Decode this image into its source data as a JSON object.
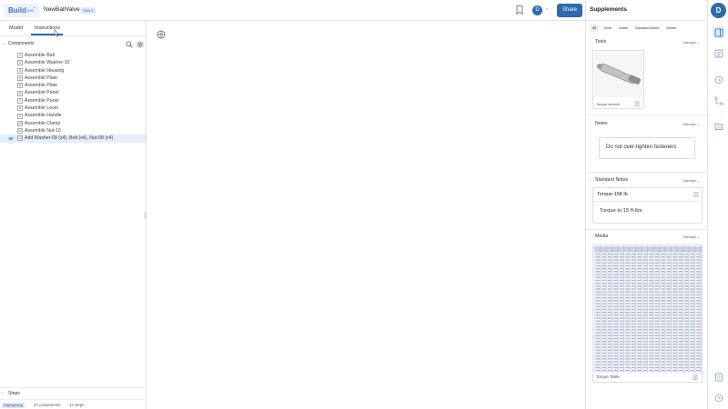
{
  "topbar": {
    "logo_text": "Build",
    "logo_superscript": "395",
    "document_title": "NewBallValve",
    "revision": "Rev 1",
    "user_initial": "D",
    "share_label": "Share"
  },
  "left_panel": {
    "tabs": [
      {
        "label": "Model"
      },
      {
        "label": "Instructions"
      }
    ],
    "components_title": "Components",
    "steps": [
      {
        "num": "1",
        "label": "Assemble Ball"
      },
      {
        "num": "2",
        "label": "Assemble Washer-10"
      },
      {
        "num": "3",
        "label": "Assemble Housing"
      },
      {
        "num": "4",
        "label": "Assemble Plate"
      },
      {
        "num": "5",
        "label": "Assemble Plate"
      },
      {
        "num": "6",
        "label": "Assemble Panel"
      },
      {
        "num": "7",
        "label": "Assemble Panel"
      },
      {
        "num": "8",
        "label": "Assemble Lever"
      },
      {
        "num": "9",
        "label": "Assemble Handle"
      },
      {
        "num": "10",
        "label": "Assemble Clamp"
      },
      {
        "num": "11",
        "label": "Assemble Nut-10"
      },
      {
        "num": "12",
        "label": "Add Washer-08 (x4), Bolt (x4), Nut-08 (x4)"
      }
    ],
    "steps_section_title": "Steps",
    "status": {
      "mode": "Highlighting",
      "components": "27 components",
      "steps": "12 steps"
    }
  },
  "supplements": {
    "title": "Supplements",
    "tabs": [
      {
        "label": "All"
      },
      {
        "label": "Tools"
      },
      {
        "label": "Notes"
      },
      {
        "label": "Standard Notes"
      },
      {
        "label": "Media"
      }
    ],
    "manage_label": "Manage",
    "tools": {
      "title": "Tools",
      "item_name": "Torque wrench"
    },
    "notes": {
      "title": "Notes",
      "text": "Do not over-tighten fasteners"
    },
    "standard_notes": {
      "title": "Standard Notes",
      "item_name": "Torque-15ft lb",
      "text": "Torque to 15 ft-lbs"
    },
    "media": {
      "title": "Media",
      "item_name": "Torque Table"
    }
  },
  "right_rail": {
    "user_initial": "D"
  },
  "colors": {
    "accent": "#2d6ab0",
    "selected_row": "#e4edf8",
    "border": "#e2e2e2"
  }
}
